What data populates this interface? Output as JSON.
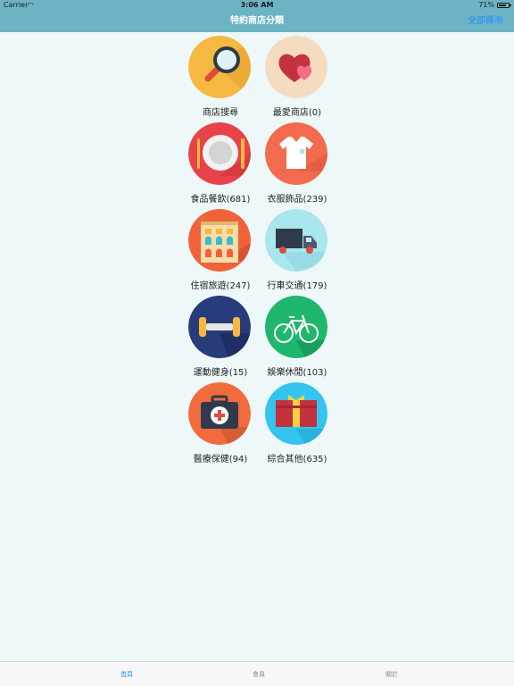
{
  "status_bar": {
    "carrier": "Carrier",
    "time": "3:06 AM",
    "battery": "71%"
  },
  "nav": {
    "title": "特約商店分類",
    "right_button": "全部縣市"
  },
  "categories": [
    {
      "label": "商店搜尋",
      "icon": "magnifier-icon",
      "color": "#f5b942"
    },
    {
      "label": "最愛商店(0)",
      "icon": "hearts-icon",
      "color": "#f5dcc0"
    },
    {
      "label": "食品餐飲(681)",
      "icon": "plate-cutlery-icon",
      "color": "#e8434a"
    },
    {
      "label": "衣服飾品(239)",
      "icon": "shirt-icon",
      "color": "#f26b4f"
    },
    {
      "label": "住宿旅遊(247)",
      "icon": "building-icon",
      "color": "#f0623a"
    },
    {
      "label": "行車交通(179)",
      "icon": "truck-icon",
      "color": "#a9e6ee"
    },
    {
      "label": "運動健身(15)",
      "icon": "dumbbell-icon",
      "color": "#283b7a"
    },
    {
      "label": "娛樂休閒(103)",
      "icon": "bicycle-icon",
      "color": "#1fb76d"
    },
    {
      "label": "醫療保健(94)",
      "icon": "medical-kit-icon",
      "color": "#f26b3d"
    },
    {
      "label": "綜合其他(635)",
      "icon": "gift-icon",
      "color": "#33c4f0"
    }
  ],
  "tabs": [
    {
      "label": "首頁",
      "active": true
    },
    {
      "label": "會員",
      "active": false
    },
    {
      "label": "關於",
      "active": false
    }
  ],
  "colors": {
    "bar": "#6cb4c4",
    "accent": "#1e8fff",
    "background": "#eef8f8"
  }
}
